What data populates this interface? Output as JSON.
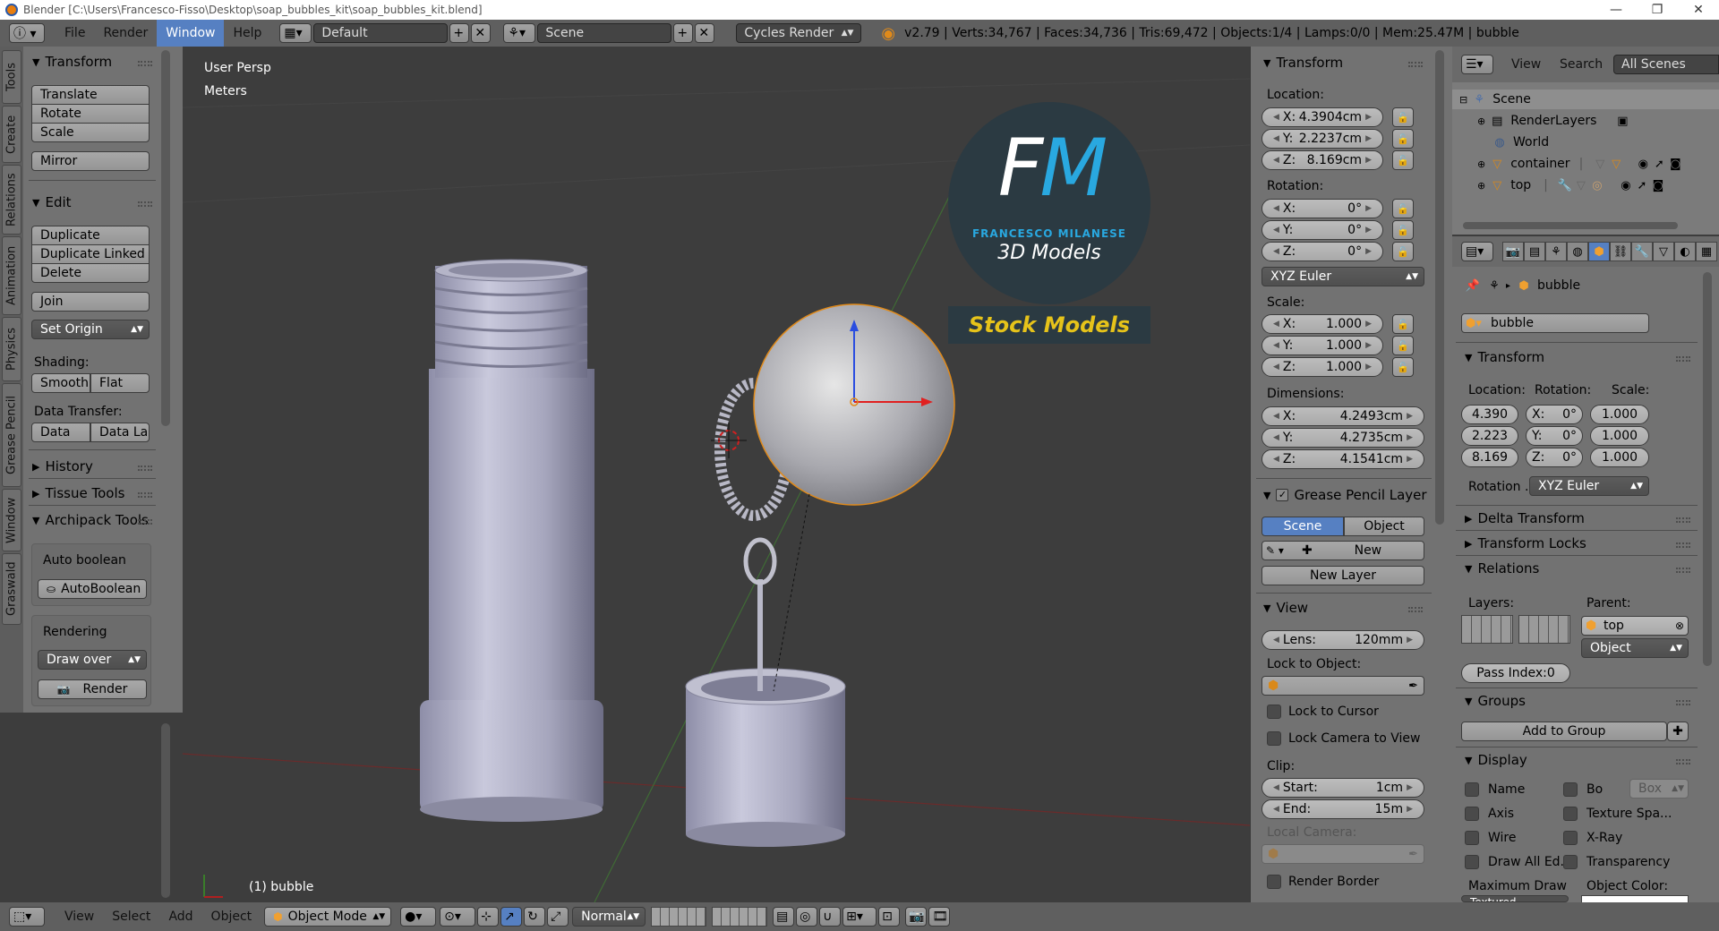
{
  "window": {
    "title": "Blender [C:\\Users\\Francesco-Fisso\\Desktop\\soap_bubbles_kit\\soap_bubbles_kit.blend]",
    "min": "—",
    "max": "❐",
    "close": "✕"
  },
  "topbar": {
    "menus": [
      "File",
      "Render",
      "Window",
      "Help"
    ],
    "active_menu": "Window",
    "layout": "Default",
    "scene": "Scene",
    "engine": "Cycles Render",
    "stats": "v2.79 | Verts:34,767 | Faces:34,736 | Tris:69,472 | Objects:1/4 | Lamps:0/0 | Mem:25.47M | bubble"
  },
  "tabs": [
    "Tools",
    "Create",
    "Relations",
    "Animation",
    "Physics",
    "Grease Pencil",
    "Window",
    "Graswald"
  ],
  "tools": {
    "transform_title": "Transform",
    "transform_buttons": [
      "Translate",
      "Rotate",
      "Scale"
    ],
    "mirror": "Mirror",
    "edit_title": "Edit",
    "edit_buttons": [
      "Duplicate",
      "Duplicate Linked",
      "Delete"
    ],
    "join": "Join",
    "set_origin": "Set Origin",
    "shading_label": "Shading:",
    "smooth": "Smooth",
    "flat": "Flat",
    "data_transfer_label": "Data Transfer:",
    "data": "Data",
    "data_la": "Data La",
    "history": "History",
    "tissue": "Tissue Tools",
    "archipack": "Archipack Tools",
    "auto_boolean_label": "Auto boolean",
    "auto_boolean_btn": "AutoBoolean",
    "rendering_label": "Rendering",
    "draw_over": "Draw over",
    "render": "Render"
  },
  "viewport": {
    "persp": "User Persp",
    "units": "Meters",
    "object_label": "(1) bubble",
    "logo_fm": "FM",
    "logo_name": "FRANCESCO MILANESE",
    "logo_3d": "3D Models",
    "logo_stock": "Stock Models"
  },
  "properties_n": {
    "transform_title": "Transform",
    "location_label": "Location:",
    "location": [
      {
        "k": "X:",
        "v": "4.3904cm"
      },
      {
        "k": "Y:",
        "v": "2.2237cm"
      },
      {
        "k": "Z:",
        "v": "8.169cm"
      }
    ],
    "rotation_label": "Rotation:",
    "rotation": [
      {
        "k": "X:",
        "v": "0°"
      },
      {
        "k": "Y:",
        "v": "0°"
      },
      {
        "k": "Z:",
        "v": "0°"
      }
    ],
    "rotation_mode": "XYZ Euler",
    "scale_label": "Scale:",
    "scale": [
      {
        "k": "X:",
        "v": "1.000"
      },
      {
        "k": "Y:",
        "v": "1.000"
      },
      {
        "k": "Z:",
        "v": "1.000"
      }
    ],
    "dimensions_label": "Dimensions:",
    "dimensions": [
      {
        "k": "X:",
        "v": "4.2493cm"
      },
      {
        "k": "Y:",
        "v": "4.2735cm"
      },
      {
        "k": "Z:",
        "v": "4.1541cm"
      }
    ],
    "grease_title": "Grease Pencil Layer",
    "scene_btn": "Scene",
    "object_btn": "Object",
    "new_btn": "New",
    "new_layer_btn": "New Layer",
    "view_title": "View",
    "lens_label": "Lens:",
    "lens_value": "120mm",
    "lock_object_label": "Lock to Object:",
    "lock_cursor": "Lock to Cursor",
    "lock_camera": "Lock Camera to View",
    "clip_label": "Clip:",
    "clip_start_label": "Start:",
    "clip_start": "1cm",
    "clip_end_label": "End:",
    "clip_end": "15m",
    "local_camera_label": "Local Camera:",
    "render_border": "Render Border"
  },
  "outliner": {
    "view": "View",
    "search": "Search",
    "filter": "All Scenes",
    "rows": [
      "Scene",
      "RenderLayers",
      "World",
      "container",
      "top"
    ]
  },
  "props": {
    "breadcrumb_obj": "bubble",
    "object_name": "bubble",
    "transform_title": "Transform",
    "location_label": "Location:",
    "rotation_label": "Rotation:",
    "scale_label": "Scale:",
    "loc": [
      "4.390",
      "2.223",
      "8.169"
    ],
    "rot": [
      {
        "k": "X:",
        "v": "0°"
      },
      {
        "k": "Y:",
        "v": "0°"
      },
      {
        "k": "Z:",
        "v": "0°"
      }
    ],
    "scl": [
      "1.000",
      "1.000",
      "1.000"
    ],
    "rotation_mode_label": "Rotation ...",
    "rotation_mode": "XYZ Euler",
    "delta_transform": "Delta Transform",
    "transform_locks": "Transform Locks",
    "relations_title": "Relations",
    "layers_label": "Layers:",
    "parent_label": "Parent:",
    "parent_value": "top",
    "parent_type": "Object",
    "pass_index": "Pass Index:0",
    "groups_title": "Groups",
    "add_to_group": "Add to Group",
    "display_title": "Display",
    "disp_name": "Name",
    "disp_bo": "Bo",
    "disp_box": "Box",
    "disp_axis": "Axis",
    "disp_texture_space": "Texture Spa...",
    "disp_wire": "Wire",
    "disp_xray": "X-Ray",
    "disp_draw_all": "Draw All Ed...",
    "disp_transparency": "Transparency",
    "max_draw_label": "Maximum Draw",
    "object_color_label": "Object Color:",
    "max_draw_value": "Textured"
  },
  "bottombar": {
    "view": "View",
    "select": "Select",
    "add": "Add",
    "object": "Object",
    "mode": "Object Mode",
    "pivot": "Normal"
  }
}
